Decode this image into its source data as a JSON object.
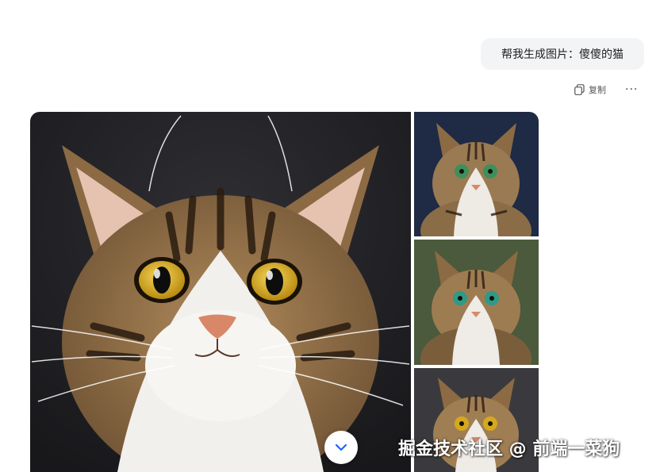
{
  "conversation": {
    "user_message": "帮我生成图片：傻傻的猫"
  },
  "message_actions": {
    "copy_label": "复制",
    "more_glyph": "···"
  },
  "images": [
    {
      "icon": "cat-image",
      "background": "#232327"
    },
    {
      "icon": "cat-image",
      "background": "#1f2a44"
    },
    {
      "icon": "cat-image",
      "background": "#4b5a3c"
    },
    {
      "icon": "cat-image",
      "background": "#3a3a3e"
    }
  ],
  "controls": {
    "scroll_icon": "chevron-down-icon",
    "accent": "#1a66ff"
  },
  "watermark": "掘金技术社区 @ 前端一菜狗"
}
